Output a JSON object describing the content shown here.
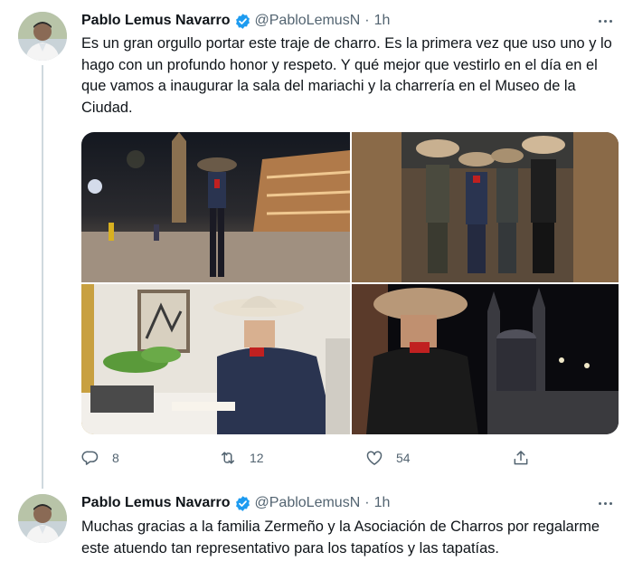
{
  "thread": {
    "tweets": [
      {
        "author_name": "Pablo Lemus Navarro",
        "handle": "@PabloLemusN",
        "separator": "·",
        "time": "1h",
        "text": "Es un gran orgullo portar este traje de charro. Es la primera vez que uso uno y lo hago con un profundo honor y respeto. Y qué mejor que vestirlo en el día en el que vamos a inaugurar la sala del mariachi y la charrería en el Museo de la Ciudad.",
        "media": [
          {
            "icon": "photo-night-plaza"
          },
          {
            "icon": "photo-group-charros"
          },
          {
            "icon": "photo-signing-desk"
          },
          {
            "icon": "photo-cathedral-night"
          }
        ],
        "actions": {
          "reply_count": "8",
          "retweet_count": "12",
          "like_count": "54",
          "share_count": ""
        }
      },
      {
        "author_name": "Pablo Lemus Navarro",
        "handle": "@PabloLemusN",
        "separator": "·",
        "time": "1h",
        "text": "Muchas gracias a la familia Zermeño y la Asociación de Charros por regalarme este atuendo tan representativo para los tapatíos y las tapatías."
      }
    ]
  },
  "colors": {
    "verified_blue": "#1d9bf0",
    "secondary_text": "#536471",
    "thread_line": "#cfd9de"
  }
}
